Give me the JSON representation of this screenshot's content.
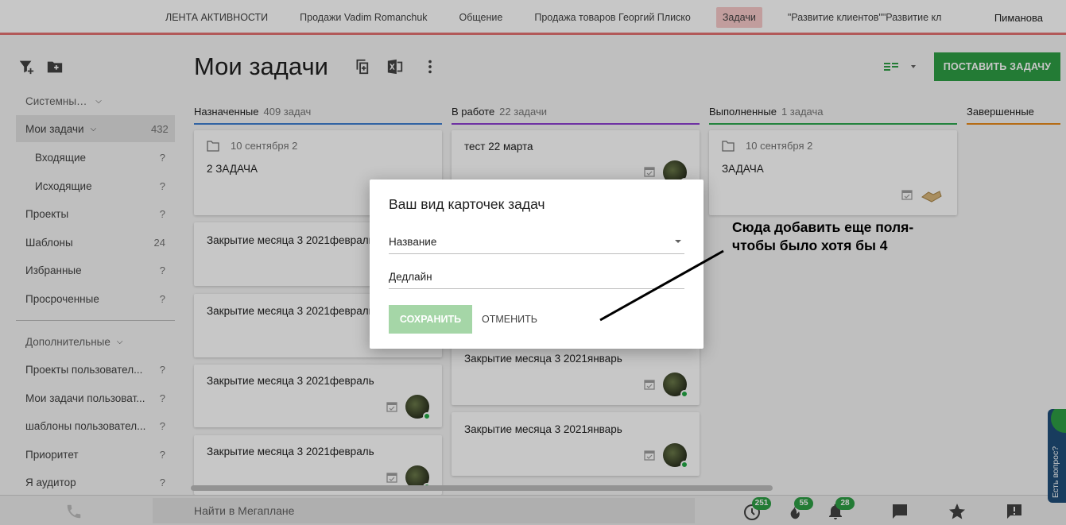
{
  "topnav": {
    "tabs": [
      {
        "label": "ЛЕНТА АКТИВНОСТИ"
      },
      {
        "label": "Продажи Vadim Romanchuk"
      },
      {
        "label": "Общение"
      },
      {
        "label": "Продажа товаров Георгий Плиско"
      },
      {
        "label": "Задачи",
        "active": true
      },
      {
        "label": "\"Развитие клиентов\"\"Развитие кл"
      }
    ],
    "user": "Пиманова"
  },
  "sidebar": {
    "icons": [
      "filter-add-icon",
      "folder-add-icon"
    ],
    "items": [
      {
        "label": "Системные фильтры",
        "count": "",
        "type": "group"
      },
      {
        "label": "Мои задачи",
        "count": "432",
        "type": "selected"
      },
      {
        "label": "Входящие",
        "count": "?",
        "type": "sub"
      },
      {
        "label": "Исходящие",
        "count": "?",
        "type": "sub"
      },
      {
        "label": "Проекты",
        "count": "?",
        "type": "item"
      },
      {
        "label": "Шаблоны",
        "count": "24",
        "type": "item"
      },
      {
        "label": "Избранные",
        "count": "?",
        "type": "item"
      },
      {
        "label": "Просроченные",
        "count": "?",
        "type": "item"
      },
      {
        "label": "Дополнительные",
        "count": "",
        "type": "group"
      },
      {
        "label": "Проекты пользовател...",
        "count": "?",
        "type": "item"
      },
      {
        "label": "Мои задачи пользоват...",
        "count": "?",
        "type": "item"
      },
      {
        "label": "шаблоны пользовател...",
        "count": "?",
        "type": "item"
      },
      {
        "label": "Приоритет",
        "count": "?",
        "type": "item"
      },
      {
        "label": "Я аудитор",
        "count": "?",
        "type": "item"
      }
    ]
  },
  "header": {
    "title": "Мои задачи",
    "add_task_label": "ПОСТАВИТЬ ЗАДАЧУ"
  },
  "columns": [
    {
      "name": "Назначенные",
      "count": "409 задач",
      "color": "#3f7fd1"
    },
    {
      "name": "В работе",
      "count": "22 задачи",
      "color": "#8e3fd1"
    },
    {
      "name": "Выполненные",
      "count": "1 задача",
      "color": "#2ea84f"
    },
    {
      "name": "Завершенные",
      "count": "",
      "color": "#e88a1a"
    }
  ],
  "cards": {
    "col1": [
      {
        "folder": "10 сентября 2",
        "title": "2 ЗАДАЧА"
      },
      {
        "title": "Закрытие месяца 3 2021февраль"
      },
      {
        "title": "Закрытие месяца 3 2021февраль"
      },
      {
        "title": "Закрытие месяца 3 2021февраль"
      },
      {
        "title": "Закрытие месяца 3 2021февраль"
      }
    ],
    "col2": [
      {
        "title": "тест 22 марта"
      },
      {
        "title": "Закрытие месяца 3 2021январь"
      },
      {
        "title": "Закрытие месяца 3 2021январь"
      }
    ],
    "col3": [
      {
        "folder": "10 сентября 2",
        "title": "ЗАДАЧА"
      }
    ]
  },
  "dialog": {
    "title": "Ваш вид карточек задач",
    "field1": "Название",
    "field2": "Дедлайн",
    "save_label": "СОХРАНИТЬ",
    "cancel_label": "ОТМЕНИТЬ"
  },
  "annotation": {
    "line1": "Сюда добавить еще поля-",
    "line2": "чтобы было хотя бы 4"
  },
  "bottombar": {
    "search_placeholder": "Найти в Мегаплане",
    "badges": {
      "tasks": "251",
      "hot": "55",
      "notifications": "28"
    }
  },
  "help_tab": {
    "label": "Есть вопрос?"
  },
  "colors": {
    "accent": "#2e9e44",
    "nav_underline": "#e57373",
    "active_tab_bg": "#f8c9c9",
    "save_disabled": "#a5d6a7"
  }
}
